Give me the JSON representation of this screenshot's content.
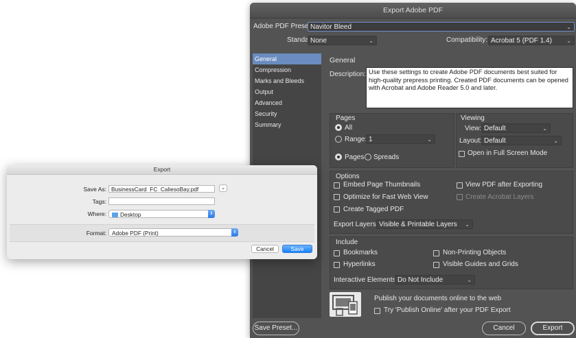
{
  "pdf_dialog": {
    "title": "Export Adobe PDF",
    "preset_label": "Adobe PDF Preset:",
    "preset_value": "Navitor Bleed",
    "standard_label": "Standard:",
    "standard_value": "None",
    "compat_label": "Compatibility:",
    "compat_value": "Acrobat 5 (PDF 1.4)",
    "sidebar": [
      "General",
      "Compression",
      "Marks and Bleeds",
      "Output",
      "Advanced",
      "Security",
      "Summary"
    ],
    "section_title": "General",
    "description_label": "Description:",
    "description": "Use these settings to create Adobe PDF documents best suited for high-quality prepress printing.  Created PDF documents can be opened with Acrobat and Adobe Reader 5.0 and later.",
    "pages": {
      "title": "Pages",
      "all": "All",
      "range": "Range:",
      "range_value": "1",
      "pages": "Pages",
      "spreads": "Spreads"
    },
    "viewing": {
      "title": "Viewing",
      "view_label": "View:",
      "view_value": "Default",
      "layout_label": "Layout:",
      "layout_value": "Default",
      "fullscreen": "Open in Full Screen Mode"
    },
    "options": {
      "title": "Options",
      "embed_thumbs": "Embed Page Thumbnails",
      "view_after": "View PDF after Exporting",
      "optimize": "Optimize for Fast Web View",
      "create_layers": "Create Acrobat Layers",
      "tagged": "Create Tagged PDF",
      "export_layers_label": "Export Layers:",
      "export_layers_value": "Visible & Printable Layers"
    },
    "include": {
      "title": "Include",
      "bookmarks": "Bookmarks",
      "nonprinting": "Non-Printing Objects",
      "hyperlinks": "Hyperlinks",
      "guides": "Visible Guides and Grids",
      "interactive_label": "Interactive Elements:",
      "interactive_value": "Do Not Include"
    },
    "publish": {
      "heading": "Publish your documents online to the web",
      "try": "Try 'Publish Online' after your PDF Export"
    },
    "buttons": {
      "save_preset": "Save Preset...",
      "cancel": "Cancel",
      "export": "Export"
    }
  },
  "export_dialog": {
    "title": "Export",
    "save_as_label": "Save As:",
    "save_as_value": "BusinessCard_FC_CaliesoBay.pdf",
    "tags_label": "Tags:",
    "where_label": "Where:",
    "where_value": "Desktop",
    "format_label": "Format:",
    "format_value": "Adobe PDF (Print)",
    "cancel": "Cancel",
    "save": "Save"
  }
}
